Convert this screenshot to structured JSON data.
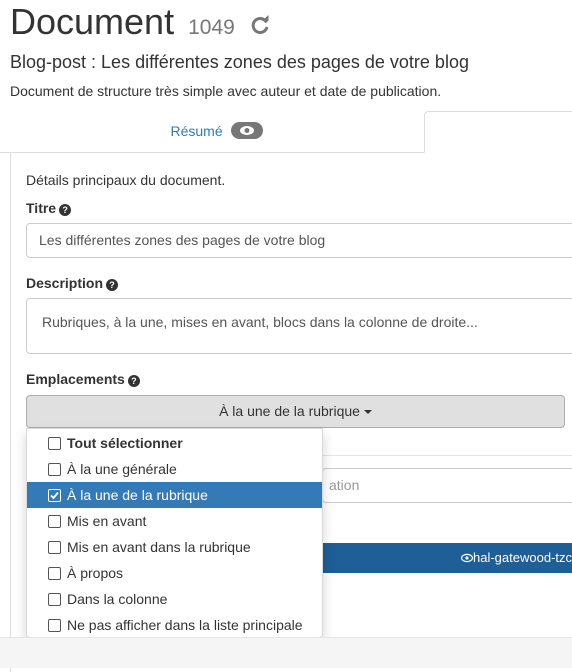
{
  "header": {
    "title": "Document",
    "doc_id": "1049",
    "refresh_icon": "refresh-icon",
    "subtitle": "Blog-post : Les différentes zones des pages de votre blog",
    "description": "Document de structure très simple avec auteur et date de publication."
  },
  "tabs": [
    {
      "label": "Résumé",
      "icon": "eye-icon",
      "active": false
    },
    {
      "label": "",
      "active": true
    }
  ],
  "panel": {
    "intro": "Détails principaux du document.",
    "titre": {
      "label": "Titre",
      "value": "Les différentes zones des pages de votre blog",
      "help_icon": "question-circle-icon"
    },
    "description": {
      "label": "Description",
      "value": "Rubriques, à la une, mises en avant, blocs dans la colonne de droite...",
      "help_icon": "question-circle-icon"
    },
    "emplacements": {
      "label": "Emplacements",
      "help_icon": "question-circle-icon",
      "selected_display": "À la une de la rubrique",
      "options": [
        {
          "label": "Tout sélectionner",
          "checked": false,
          "bold": true,
          "highlighted": false
        },
        {
          "label": "À la une générale",
          "checked": false,
          "bold": false,
          "highlighted": false
        },
        {
          "label": "À la une de la rubrique",
          "checked": true,
          "bold": false,
          "highlighted": true
        },
        {
          "label": "Mis en avant",
          "checked": false,
          "bold": false,
          "highlighted": false
        },
        {
          "label": "Mis en avant dans la rubrique",
          "checked": false,
          "bold": false,
          "highlighted": false
        },
        {
          "label": "À propos",
          "checked": false,
          "bold": false,
          "highlighted": false
        },
        {
          "label": "Dans la colonne",
          "checked": false,
          "bold": false,
          "highlighted": false
        },
        {
          "label": "Ne pas afficher dans la liste principale",
          "checked": false,
          "bold": false,
          "highlighted": false
        }
      ]
    },
    "hidden_input_fragment": "ation",
    "author_chip": "hal-gatewood-tzc"
  },
  "colors": {
    "accent": "#337ab7",
    "author_bar": "#1d5f96",
    "dropdown_button": "#e0e0e0"
  }
}
